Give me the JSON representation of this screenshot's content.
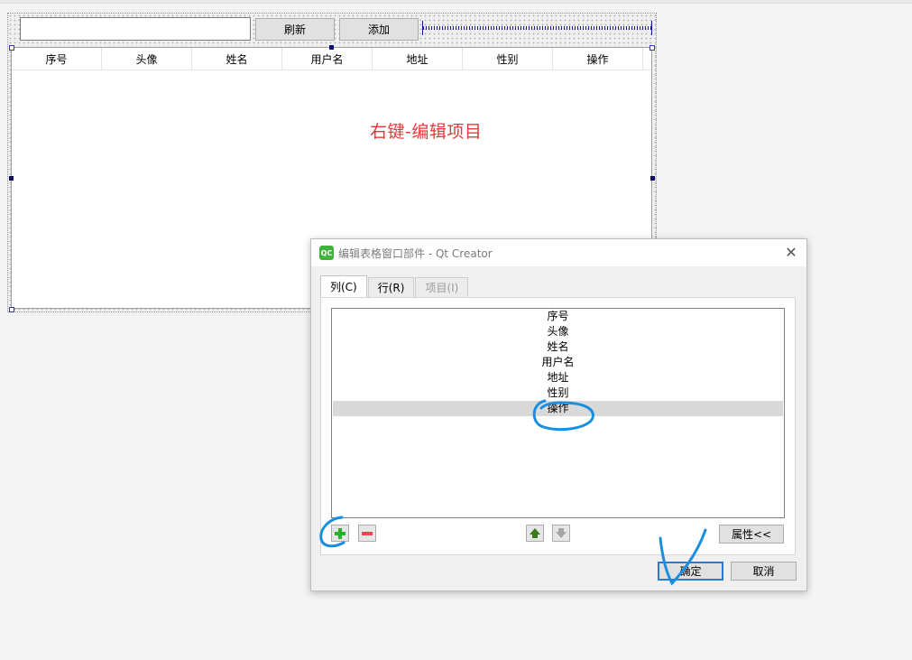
{
  "form": {
    "search_value": "",
    "refresh_label": "刷新",
    "add_label": "添加",
    "table_headers": [
      "序号",
      "头像",
      "姓名",
      "用户名",
      "地址",
      "性别",
      "操作"
    ],
    "hint_text": "右键-编辑项目",
    "hint_color": "#e03a3a"
  },
  "dialog": {
    "app_icon_text": "QC",
    "title": "编辑表格窗口部件 - Qt Creator",
    "tabs": [
      {
        "label": "列(C)",
        "state": "active"
      },
      {
        "label": "行(R)",
        "state": "normal"
      },
      {
        "label": "项目(I)",
        "state": "disabled"
      }
    ],
    "columns": [
      "序号",
      "头像",
      "姓名",
      "用户名",
      "地址",
      "性别",
      "操作"
    ],
    "selected_column": "操作",
    "properties_label": "属性<<",
    "ok_label": "确定",
    "cancel_label": "取消"
  },
  "colors": {
    "annotation": "#1a8fe0",
    "accent_focus": "#2a7bd3"
  },
  "icons": [
    "qc-icon",
    "close-icon",
    "plus-icon",
    "minus-icon",
    "arrow-up-icon",
    "arrow-down-icon"
  ]
}
